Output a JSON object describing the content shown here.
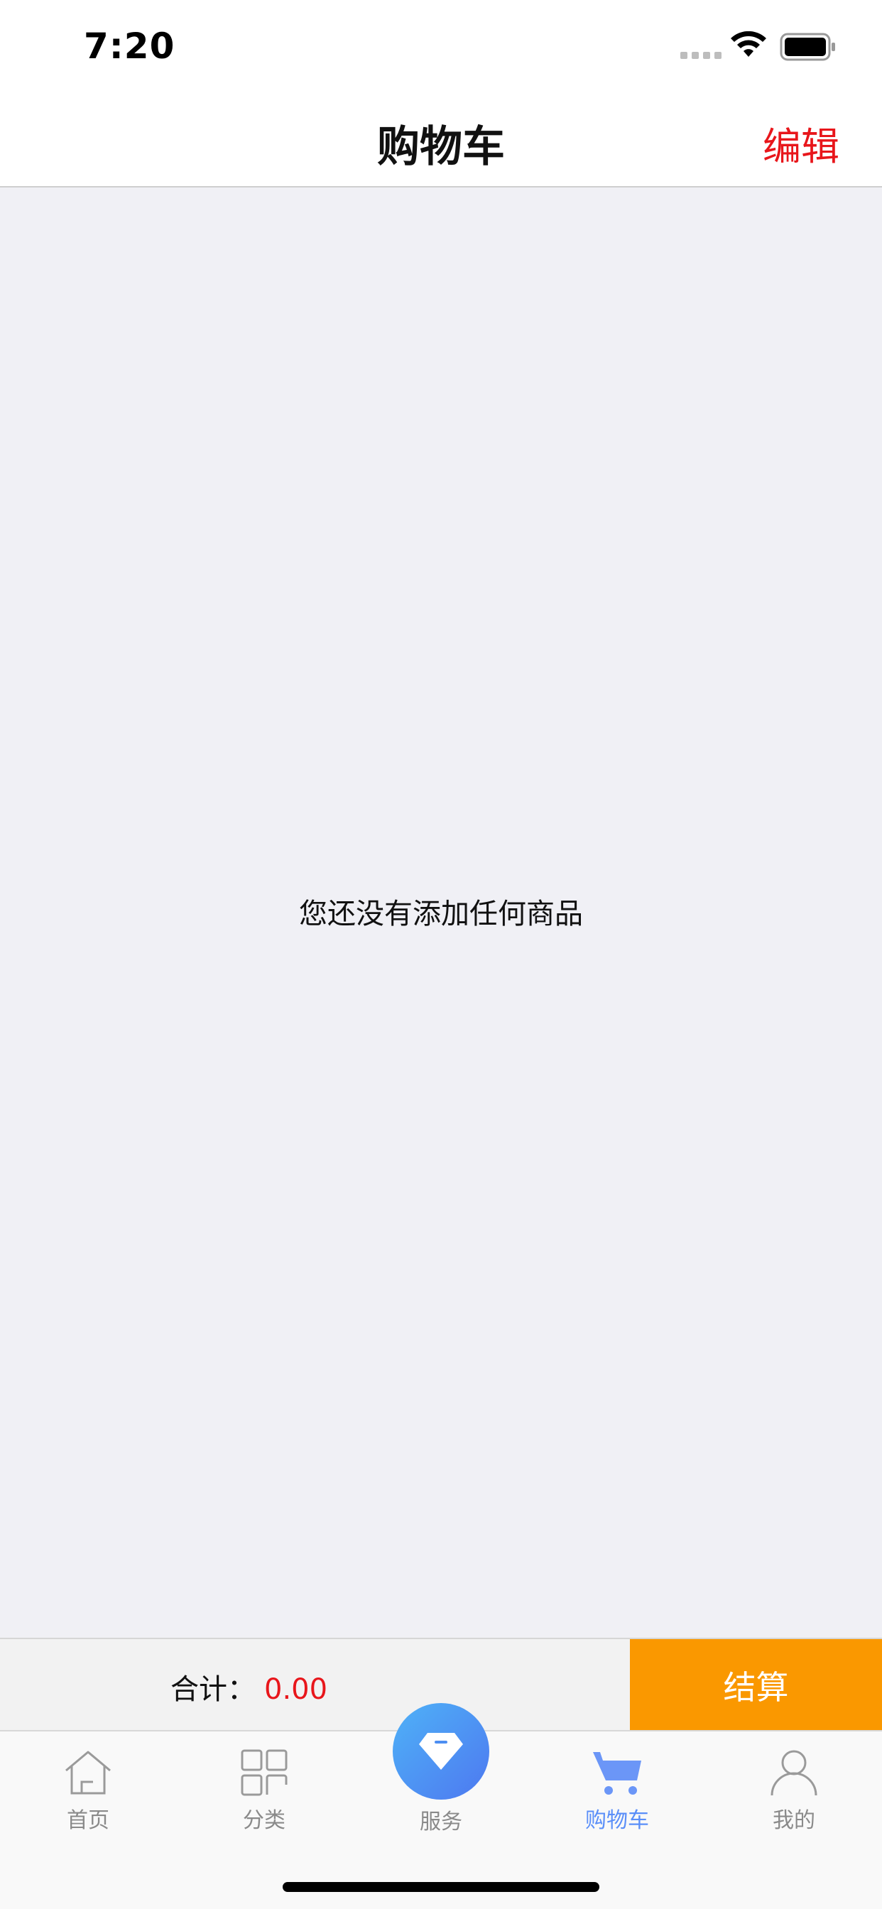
{
  "status_bar": {
    "time": "7:20"
  },
  "nav": {
    "title": "购物车",
    "edit_label": "编辑"
  },
  "content": {
    "empty_message": "您还没有添加任何商品"
  },
  "checkout": {
    "total_label": "合计：",
    "total_value": "0.00",
    "checkout_label": "结算"
  },
  "tabs": [
    {
      "label": "首页",
      "icon": "home-icon",
      "active": false
    },
    {
      "label": "分类",
      "icon": "category-icon",
      "active": false
    },
    {
      "label": "服务",
      "icon": "diamond-icon",
      "active": false
    },
    {
      "label": "购物车",
      "icon": "cart-icon",
      "active": true
    },
    {
      "label": "我的",
      "icon": "profile-icon",
      "active": false
    }
  ],
  "colors": {
    "accent_red": "#e8161b",
    "checkout_orange": "#fa9800",
    "active_tab_blue": "#5b8ff9"
  }
}
